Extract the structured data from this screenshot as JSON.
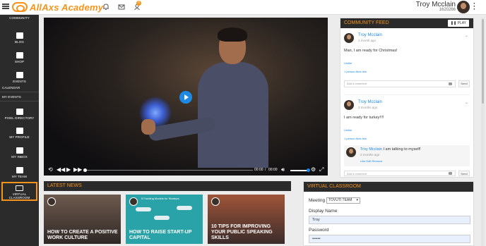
{
  "header": {
    "app_name": "AllAxs Academy",
    "notification_count": "0",
    "user_name": "Troy Mcclain",
    "user_id": "1620266"
  },
  "sidebar": {
    "items": [
      {
        "label": "COMMUNITY"
      },
      {
        "label": "BLOG"
      },
      {
        "label": "SHOP"
      },
      {
        "label": "EVENTS"
      },
      {
        "label": "CALENDAR"
      },
      {
        "label": "MY EVENTS"
      },
      {
        "label": "PIXEL DIRECTORY"
      },
      {
        "label": "MY PROFILE"
      },
      {
        "label": "MY INBOX"
      },
      {
        "label": "MY TEAM"
      },
      {
        "label": "VIRTUAL CLASSROOM"
      }
    ]
  },
  "video": {
    "current_time": "00:00",
    "separator": "/",
    "duration": "00:00"
  },
  "community_feed": {
    "title": "COMMUNITY FEED",
    "play_label": "Play",
    "posts": [
      {
        "author": "Troy Mcclain",
        "time": "1 month ago",
        "body": "Man, I am ready for Christmas!",
        "like_label": "Unlike",
        "likes_text": "1 person likes this",
        "comment_placeholder": "Add a comment",
        "send_label": "Send"
      },
      {
        "author": "Troy Mcclain",
        "time": "2 months ago",
        "body": "I am ready for turkey!!!!",
        "like_label": "Unlike",
        "likes_text": "1 person likes this",
        "reply_author": "Troy Mcclain",
        "reply_body": "I am talking to myself!",
        "reply_time": "2 months ago",
        "reply_actions": "Like Edit Remove",
        "comment_placeholder": "Add a comment",
        "send_label": "Send"
      }
    ]
  },
  "latest_news": {
    "title": "LATEST NEWS",
    "cards": [
      {
        "caption": "HOW TO CREATE A POSITIVE WORK CULTURE"
      },
      {
        "caption": "HOW TO RAISE START-UP CAPITAL",
        "subtitle": "5 Funding Models for Startups"
      },
      {
        "caption": "10 TIPS FOR IMPROVING YOUR PUBLIC SPEAKING SKILLS"
      }
    ]
  },
  "virtual_classroom": {
    "title": "VIRTUAL CLASSROOM",
    "meeting_label": "Meeting",
    "meeting_value": "TOVUTI TEAM",
    "display_name_label": "Display Name",
    "display_name_value": "Troy",
    "password_label": "Password",
    "password_value": "••••••"
  },
  "colors": {
    "accent": "#f7941d",
    "link": "#1e88e5",
    "sidebar_bg": "#2b2b2b"
  }
}
